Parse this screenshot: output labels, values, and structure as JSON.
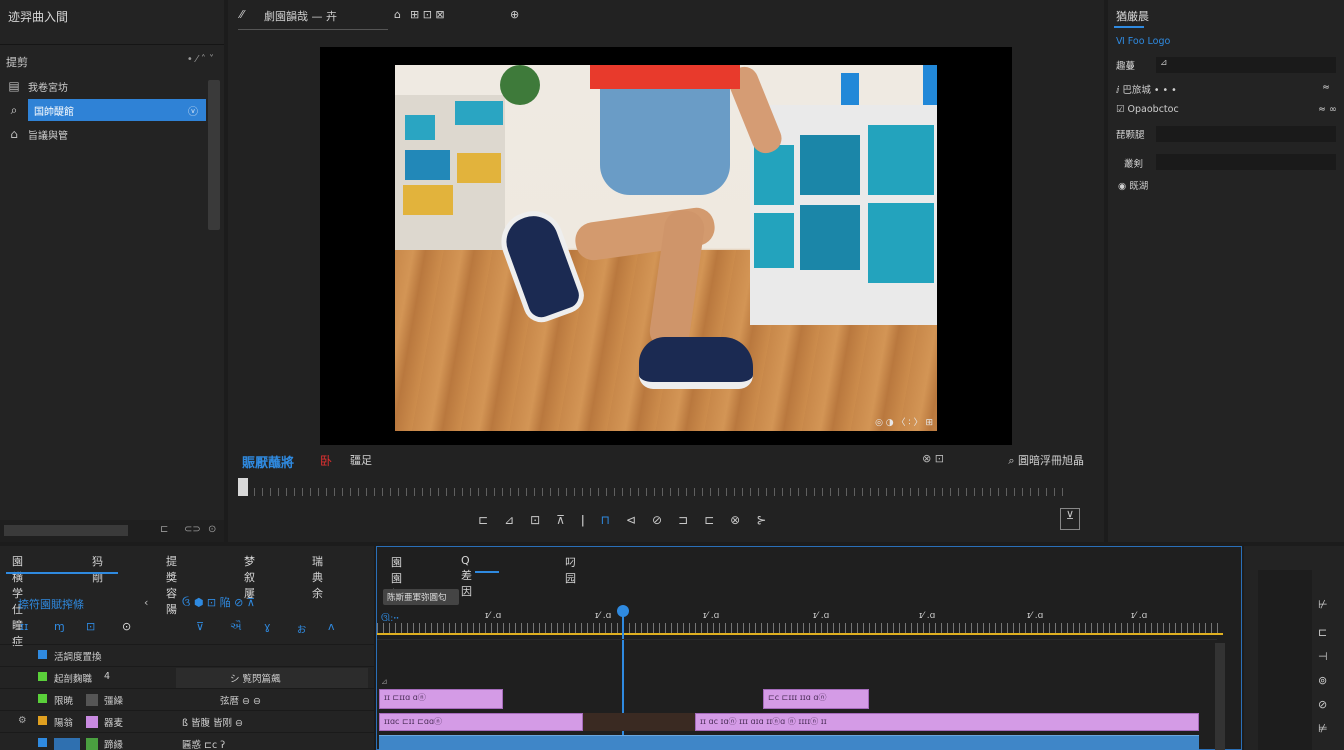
{
  "left_panel": {
    "title": "迹羿曲入間",
    "sub_label": "提剪",
    "sub_ctl": "• ⁄ ˄ ˅",
    "items": [
      {
        "icon": "▤",
        "label": "我卷宮坊"
      },
      {
        "icon": "⌕",
        "label": "国帥醍館",
        "mark": "ⓥ"
      },
      {
        "icon": "⌂",
        "label": "旨議與管"
      }
    ]
  },
  "viewer": {
    "tabs": [
      "⁄⁄",
      "劇園韻哉 — 卉",
      "⌂",
      "⊞ ⊡ ⊠",
      "⊕"
    ],
    "timecode": "賑厭蘸將",
    "red_label": "卧",
    "fit_label": "疆足",
    "right_label": "⌕ 圓暗浮冊旭晶",
    "right_icons": "⊗ ⊡",
    "watermark": "◎ ◑ 〈 ∶ 〉 ⊞",
    "transport": [
      "⊏",
      "⊿",
      "⊡",
      "⊼",
      "ǀ",
      "⊓",
      "⊲",
      "⊘",
      "⊐",
      "⊏",
      "⊗",
      "⊱"
    ],
    "export_icon": "⊻"
  },
  "right_panel": {
    "title": "猶厳晨",
    "rows": [
      {
        "k": "fx_icon",
        "label": "Ⅵ Foo Logo"
      },
      {
        "k": "field1",
        "label": "趣蔓",
        "value": "⊿"
      },
      {
        "k": "row3",
        "label": "ⅈ 巴旅城 • • •",
        "end": "≈"
      },
      {
        "k": "row4",
        "label": "☑ Opaobctoc",
        "end": "≈ ∞"
      },
      {
        "k": "row5",
        "label": "琵颗腿"
      },
      {
        "k": "row6",
        "label": "叢剣"
      },
      {
        "k": "row7",
        "label": "◉ 既湖"
      }
    ]
  },
  "timeline": {
    "left_tabs": [
      "園横学仕瞳症",
      "犸 剛",
      "提獎容陽",
      "梦叙屢",
      "瑞典余"
    ],
    "blue_row1": [
      "捺符園賦搾條",
      "‹",
      "ઉ ⬢ ⊡ 陥 ⊘ ⊼"
    ],
    "blue_row2": [
      "ɪɪ",
      "ɱ",
      "⊡",
      "⊙",
      "⊽",
      "ઐ",
      "ɣ",
      "ぉ",
      "ʌ"
    ],
    "right_tabs": [
      "園園韻",
      "Q 差因",
      "叼园"
    ],
    "seq_label": "陈斯亜軍弥圓匂",
    "ruler_labels": [
      "ઊ:ꞏꞏ",
      "ɪ⁄ .ɑ",
      "ɪ⁄ .ɑ",
      "ɪ⁄ .ɑ",
      "ɪ⁄ .ɑ",
      "ɪ⁄ .ɑ",
      "ɪ⁄ .ɑ",
      "ɪ⁄ .ɑ"
    ],
    "tracks": [
      {
        "name": "活調度置換",
        "color": "#2f8ae0",
        "mid": "",
        "right": ""
      },
      {
        "name": "起剖麴職",
        "color": "#5ad03a",
        "mid": "4",
        "right": "シ    覧閃篇飆"
      },
      {
        "name": "限暁",
        "color": "#5ad03a",
        "mid": "彊繰",
        "right": "弦暦   ⊖   ⊖"
      },
      {
        "name": "陽翁",
        "color": "#e0a020",
        "mid": "器麦",
        "right": "ß 皆腹   皆刚   ⊖"
      },
      {
        "name": "飽叢",
        "color": "#2f8ae0",
        "mid": "蹄縁",
        "right": "匾惑   ⊏ⅽ   ʔ"
      }
    ],
    "clips_a": [
      {
        "label": "ɪɪ   ⊏ɪɪɑ ɑⓝ"
      },
      {
        "label": "⊏ⅽ  ⊏ɪɪɪ  ɪɪɑ  ɑⓝ"
      }
    ],
    "clips_b": [
      {
        "label": "ɪɪɑⅽ    ⊏ɪɪ  ⊏ɑɑⓝ"
      },
      {
        "label": "ɪɪ  ɑⅽ  ɪɑⓝ   ɪɪɪ   ɑɪɑ   ɪɪⓝɑ ⓝ   ɪɪɪɪⓝ ɪɪ"
      }
    ]
  },
  "side_tools": [
    "⊬",
    "⊏",
    "⊣",
    "⊚",
    "⊘",
    "⊭"
  ]
}
